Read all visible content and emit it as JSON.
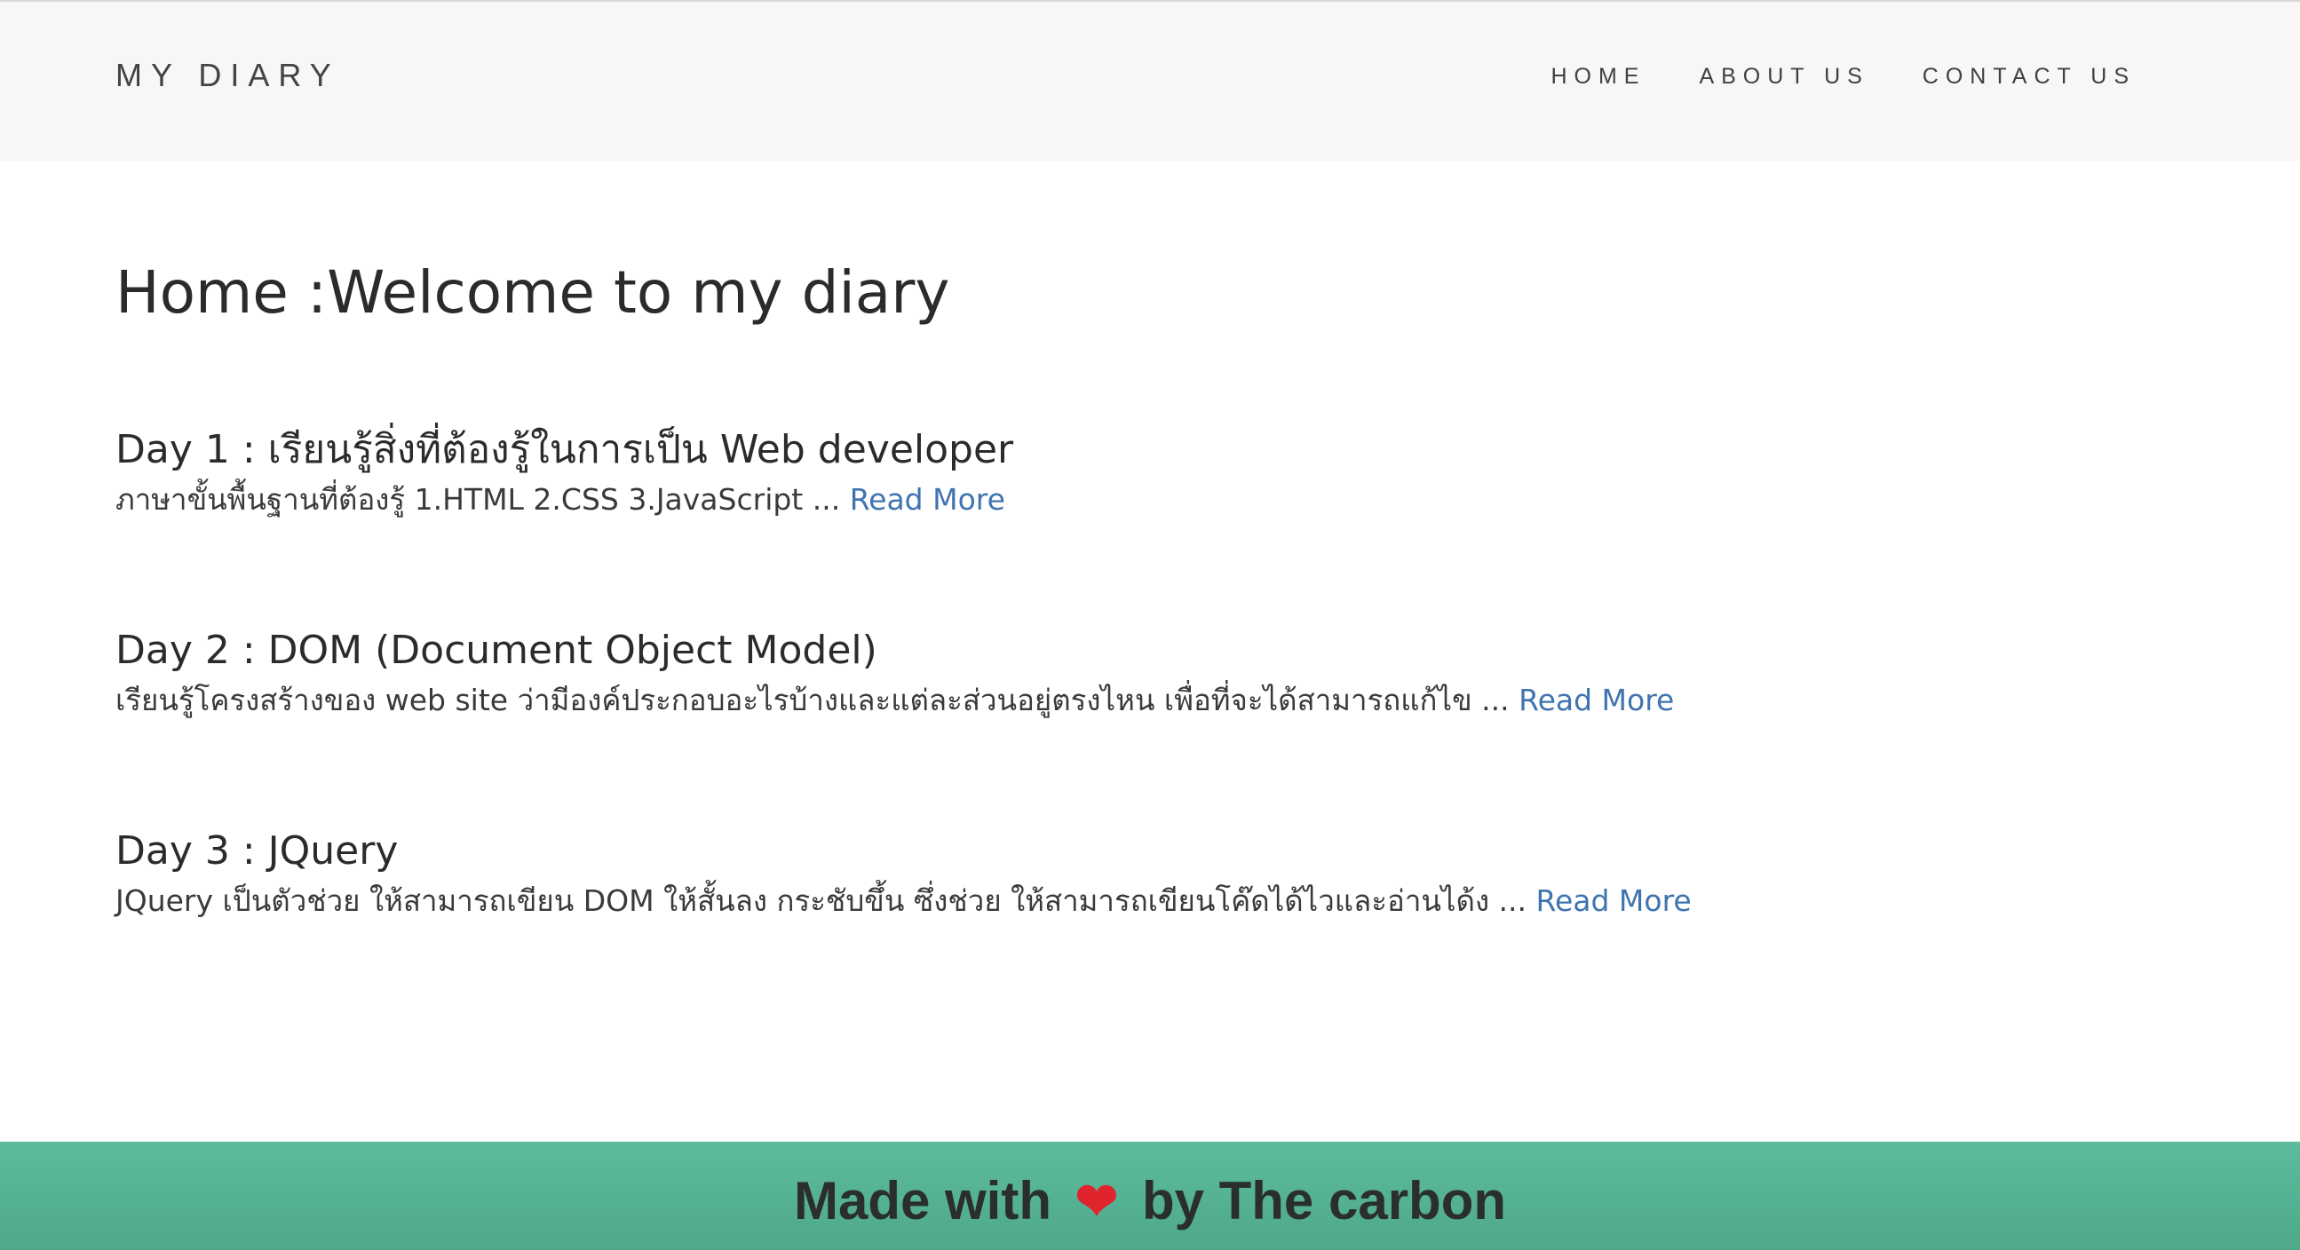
{
  "navbar": {
    "brand": "MY DIARY",
    "links": [
      "HOME",
      "ABOUT US",
      "CONTACT US"
    ]
  },
  "main": {
    "title": "Home :Welcome to my diary",
    "posts": [
      {
        "title": "Day 1 : เรียนรู้สิ่งที่ต้องรู้ในการเป็น Web developer",
        "excerpt": "ภาษาขั้นพื้นฐานที่ต้องรู้ 1.HTML 2.CSS 3.JavaScript ...",
        "read_more": "Read More"
      },
      {
        "title": "Day 2 : DOM (Document Object Model)",
        "excerpt": "เรียนรู้โครงสร้างของ web site ว่ามีองค์ประกอบอะไรบ้างและแต่ละส่วนอยู่ตรงไหน เพื่อที่จะได้สามารถแก้ไข ...",
        "read_more": "Read More"
      },
      {
        "title": "Day 3 : JQuery",
        "excerpt": "JQuery เป็นตัวช่วย ให้สามารถเขียน DOM  ให้สั้นลง กระชับขึ้น ซึ่งช่วย ให้สามารถเขียนโค๊ดได้ไวและอ่านได้ง ...",
        "read_more": "Read More"
      }
    ]
  },
  "footer": {
    "text_before": "Made with",
    "heart_icon": "heart-icon",
    "heart_glyph": "❤",
    "text_after": "by The carbon"
  },
  "colors": {
    "navbar_bg": "#f7f7f7",
    "link_blue": "#3f74b0",
    "footer_green": "#5cbc9d",
    "heart_red": "#e0242d"
  }
}
